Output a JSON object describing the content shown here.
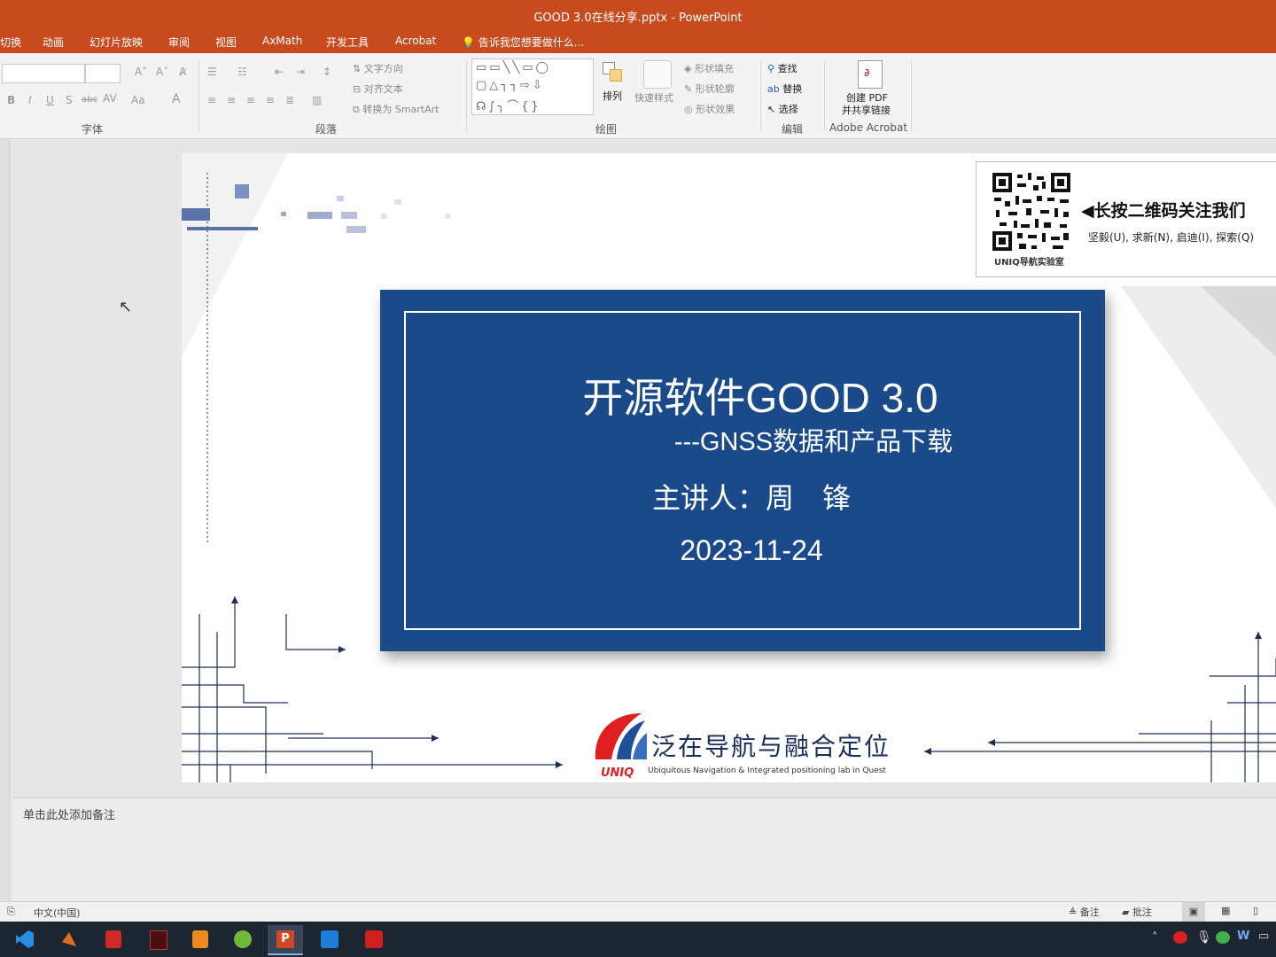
{
  "window": {
    "title": "GOOD 3.0在线分享.pptx - PowerPoint"
  },
  "tabs": [
    "切换",
    "动画",
    "幻灯片放映",
    "审阅",
    "视图",
    "AxMath",
    "开发工具",
    "Acrobat"
  ],
  "tell_me": "告诉我您想要做什么...",
  "ribbon": {
    "font_group": "字体",
    "paragraph_group": "段落",
    "drawing_group": "绘图",
    "editing_group": "编辑",
    "acrobat_group": "Adobe Acrobat",
    "text_direction": "文字方向",
    "align_text": "对齐文本",
    "convert_smartart": "转换为 SmartArt",
    "arrange": "排列",
    "quick_styles": "快速样式",
    "shape_fill": "形状填充",
    "shape_outline": "形状轮廓",
    "shape_effects": "形状效果",
    "find": "查找",
    "replace": "替换",
    "select": "选择",
    "create_pdf_line1": "创建 PDF",
    "create_pdf_line2": "并共享链接"
  },
  "slide": {
    "main_title": "开源软件GOOD 3.0",
    "subtitle": "---GNSS数据和产品下载",
    "speaker": "主讲人：周　锋",
    "date": "2023-11-24",
    "qr_caption": "UNIQ导航实验室",
    "qr_heading": "长按二维码关注我们",
    "qr_motto": "坚毅(U), 求新(N), 启迪(I), 探索(Q)",
    "logo_mark": "UNIQ",
    "logo_cn": "泛在导航与融合定位",
    "logo_en": "Ubiquitous Navigation & Integrated positioning lab in Quest"
  },
  "notes": {
    "placeholder": "单击此处添加备注"
  },
  "status": {
    "language": "中文(中国)",
    "notes_btn": "备注",
    "comments_btn": "批注"
  },
  "colors": {
    "title_bar": "#c84b1f",
    "slide_blue": "#1a4a8a"
  }
}
